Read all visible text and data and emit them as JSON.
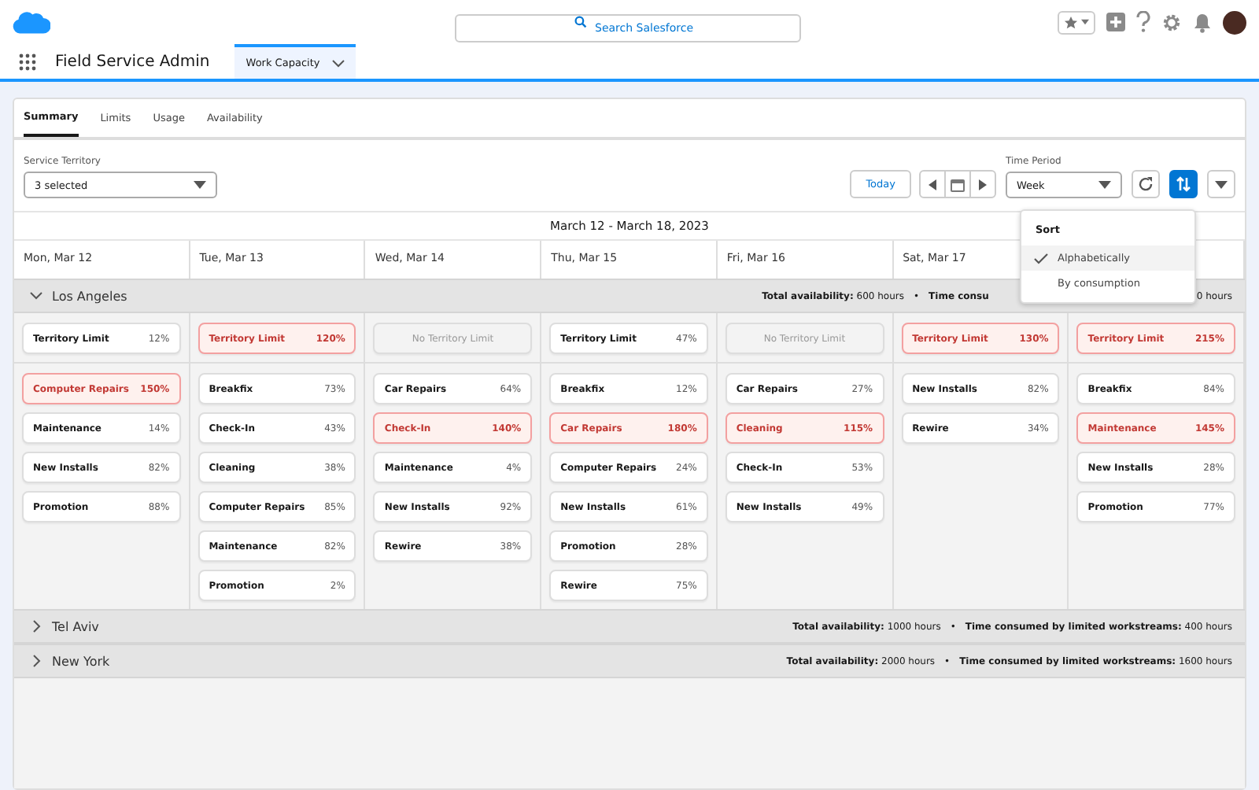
{
  "header": {
    "search_placeholder": "Search Salesforce"
  },
  "nav": {
    "app_name": "Field Service Admin",
    "tabs": [
      {
        "label": "Work Capacity",
        "selected": true
      }
    ]
  },
  "tabs": [
    {
      "label": "Summary",
      "selected": true
    },
    {
      "label": "Limits",
      "selected": false
    },
    {
      "label": "Usage",
      "selected": false
    },
    {
      "label": "Availability",
      "selected": false
    }
  ],
  "filters": {
    "territory_label": "Service Territory",
    "territory_value": "3 selected",
    "today_button": "Today",
    "period_label": "Time Period",
    "period_value": "Week"
  },
  "sort_menu": {
    "title": "Sort",
    "items": [
      {
        "label": "Alphabetically",
        "selected": true
      },
      {
        "label": "By consumption",
        "selected": false
      }
    ]
  },
  "date_range": "March 12 - March 18, 2023",
  "days": [
    {
      "label": "Mon, Mar 12",
      "territory": {
        "kind": "limit",
        "label": "Territory Limit",
        "value": "12%",
        "over": false
      },
      "items": [
        {
          "name": "Computer Repairs",
          "value": "150%",
          "over": true
        },
        {
          "name": "Maintenance",
          "value": "14%",
          "over": false
        },
        {
          "name": "New Installs",
          "value": "82%",
          "over": false
        },
        {
          "name": "Promotion",
          "value": "88%",
          "over": false
        }
      ]
    },
    {
      "label": "Tue, Mar 13",
      "territory": {
        "kind": "limit",
        "label": "Territory Limit",
        "value": "120%",
        "over": true
      },
      "items": [
        {
          "name": "Breakfix",
          "value": "73%",
          "over": false
        },
        {
          "name": "Check-In",
          "value": "43%",
          "over": false
        },
        {
          "name": "Cleaning",
          "value": "38%",
          "over": false
        },
        {
          "name": "Computer Repairs",
          "value": "85%",
          "over": false
        },
        {
          "name": "Maintenance",
          "value": "82%",
          "over": false
        },
        {
          "name": "Promotion",
          "value": "2%",
          "over": false
        }
      ]
    },
    {
      "label": "Wed, Mar 14",
      "territory": {
        "kind": "none",
        "label": "No Territory Limit"
      },
      "items": [
        {
          "name": "Car Repairs",
          "value": "64%",
          "over": false
        },
        {
          "name": "Check-In",
          "value": "140%",
          "over": true
        },
        {
          "name": "Maintenance",
          "value": "4%",
          "over": false
        },
        {
          "name": "New Installs",
          "value": "92%",
          "over": false
        },
        {
          "name": "Rewire",
          "value": "38%",
          "over": false
        }
      ]
    },
    {
      "label": "Thu, Mar 15",
      "territory": {
        "kind": "limit",
        "label": "Territory Limit",
        "value": "47%",
        "over": false
      },
      "items": [
        {
          "name": "Breakfix",
          "value": "12%",
          "over": false
        },
        {
          "name": "Car Repairs",
          "value": "180%",
          "over": true
        },
        {
          "name": "Computer Repairs",
          "value": "24%",
          "over": false
        },
        {
          "name": "New Installs",
          "value": "61%",
          "over": false
        },
        {
          "name": "Promotion",
          "value": "28%",
          "over": false
        },
        {
          "name": "Rewire",
          "value": "75%",
          "over": false
        }
      ]
    },
    {
      "label": "Fri, Mar 16",
      "territory": {
        "kind": "none",
        "label": "No Territory Limit"
      },
      "items": [
        {
          "name": "Car Repairs",
          "value": "27%",
          "over": false
        },
        {
          "name": "Cleaning",
          "value": "115%",
          "over": true
        },
        {
          "name": "Check-In",
          "value": "53%",
          "over": false
        },
        {
          "name": "New Installs",
          "value": "49%",
          "over": false
        }
      ]
    },
    {
      "label": "Sat, Mar 17",
      "territory": {
        "kind": "limit",
        "label": "Territory Limit",
        "value": "130%",
        "over": true
      },
      "items": [
        {
          "name": "New Installs",
          "value": "82%",
          "over": false
        },
        {
          "name": "Rewire",
          "value": "34%",
          "over": false
        }
      ]
    },
    {
      "territory": {
        "kind": "limit",
        "label": "Territory Limit",
        "value": "215%",
        "over": true
      },
      "items": [
        {
          "name": "Breakfix",
          "value": "84%",
          "over": false
        },
        {
          "name": "Maintenance",
          "value": "145%",
          "over": true
        },
        {
          "name": "New Installs",
          "value": "28%",
          "over": false
        },
        {
          "name": "Promotion",
          "value": "77%",
          "over": false
        }
      ]
    }
  ],
  "territories": [
    {
      "name": "Los Angeles",
      "expanded": true,
      "availability_label": "Total availability:",
      "availability": "600 hours",
      "separator": "•",
      "consumed_label": "Time consu",
      "consumed": "0 hours"
    },
    {
      "name": "Tel Aviv",
      "expanded": false,
      "availability_label": "Total availability:",
      "availability": "1000 hours",
      "separator": "•",
      "consumed_label": "Time consumed by limited workstreams:",
      "consumed": "400 hours"
    },
    {
      "name": "New York",
      "expanded": false,
      "availability_label": "Total availability:",
      "availability": "2000 hours",
      "separator": "•",
      "consumed_label": "Time consumed by limited workstreams:",
      "consumed": "1600 hours"
    }
  ]
}
